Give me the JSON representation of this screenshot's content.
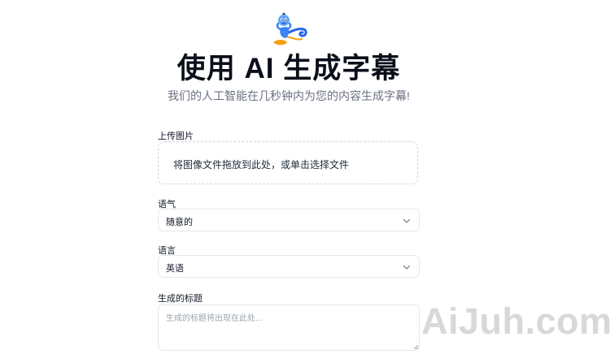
{
  "header": {
    "logo_icon": "genie-mascot-icon",
    "title": "使用 AI 生成字幕",
    "subtitle": "我们的人工智能在几秒钟内为您的内容生成字幕!"
  },
  "form": {
    "upload": {
      "label": "上传图片",
      "dropzone_text": "将图像文件拖放到此处，或单击选择文件"
    },
    "tone": {
      "label": "语气",
      "selected": "随意的",
      "icon": "chevron-down-icon"
    },
    "language": {
      "label": "语言",
      "selected": "英语",
      "icon": "chevron-down-icon"
    },
    "caption": {
      "label": "生成的标题",
      "placeholder": "生成的标题将出现在此处..."
    }
  },
  "watermark": "AiJuh.com"
}
